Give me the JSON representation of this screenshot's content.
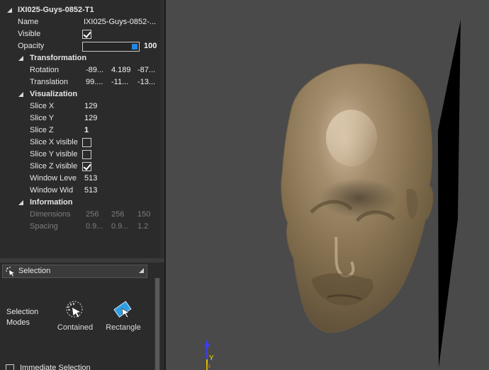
{
  "properties": {
    "title": "IXI025-Guys-0852-T1",
    "name_label": "Name",
    "name_value": "IXI025-Guys-0852-...",
    "visible_label": "Visible",
    "visible_checked": true,
    "opacity_label": "Opacity",
    "opacity_value": "100",
    "opacity_level_percent": 100,
    "transformation": {
      "header": "Transformation",
      "rotation_label": "Rotation",
      "rotation": [
        "-89...",
        "4.189",
        "-87..."
      ],
      "translation_label": "Translation",
      "translation": [
        "99....",
        "-11...",
        "-13..."
      ]
    },
    "visualization": {
      "header": "Visualization",
      "slice_x_label": "Slice X",
      "slice_x": "129",
      "slice_y_label": "Slice Y",
      "slice_y": "129",
      "slice_z_label": "Slice Z",
      "slice_z": "1",
      "slice_x_visible_label": "Slice X visible",
      "slice_x_visible": false,
      "slice_y_visible_label": "Slice Y visible",
      "slice_y_visible": false,
      "slice_z_visible_label": "Slice Z visible",
      "slice_z_visible": true,
      "window_level_label": "Window Leve",
      "window_level": "513",
      "window_width_label": "Window Wid",
      "window_width": "513"
    },
    "information": {
      "header": "Information",
      "dimensions_label": "Dimensions",
      "dimensions": [
        "256",
        "256",
        "150"
      ],
      "spacing_label": "Spacing",
      "spacing": [
        "0.9...",
        "0.9...",
        "1.2"
      ]
    }
  },
  "selection": {
    "header": "Selection",
    "modes_label": "Selection Modes",
    "modes": [
      {
        "label": "Contained",
        "icon": "contained-selection-icon"
      },
      {
        "label": "Rectangle",
        "icon": "rectangle-selection-icon"
      }
    ],
    "immediate_label": "Immediate Selection"
  },
  "viewport": {
    "axis_y_label": "Y",
    "axis_p_label": "P",
    "head_color": "#8c7658"
  }
}
